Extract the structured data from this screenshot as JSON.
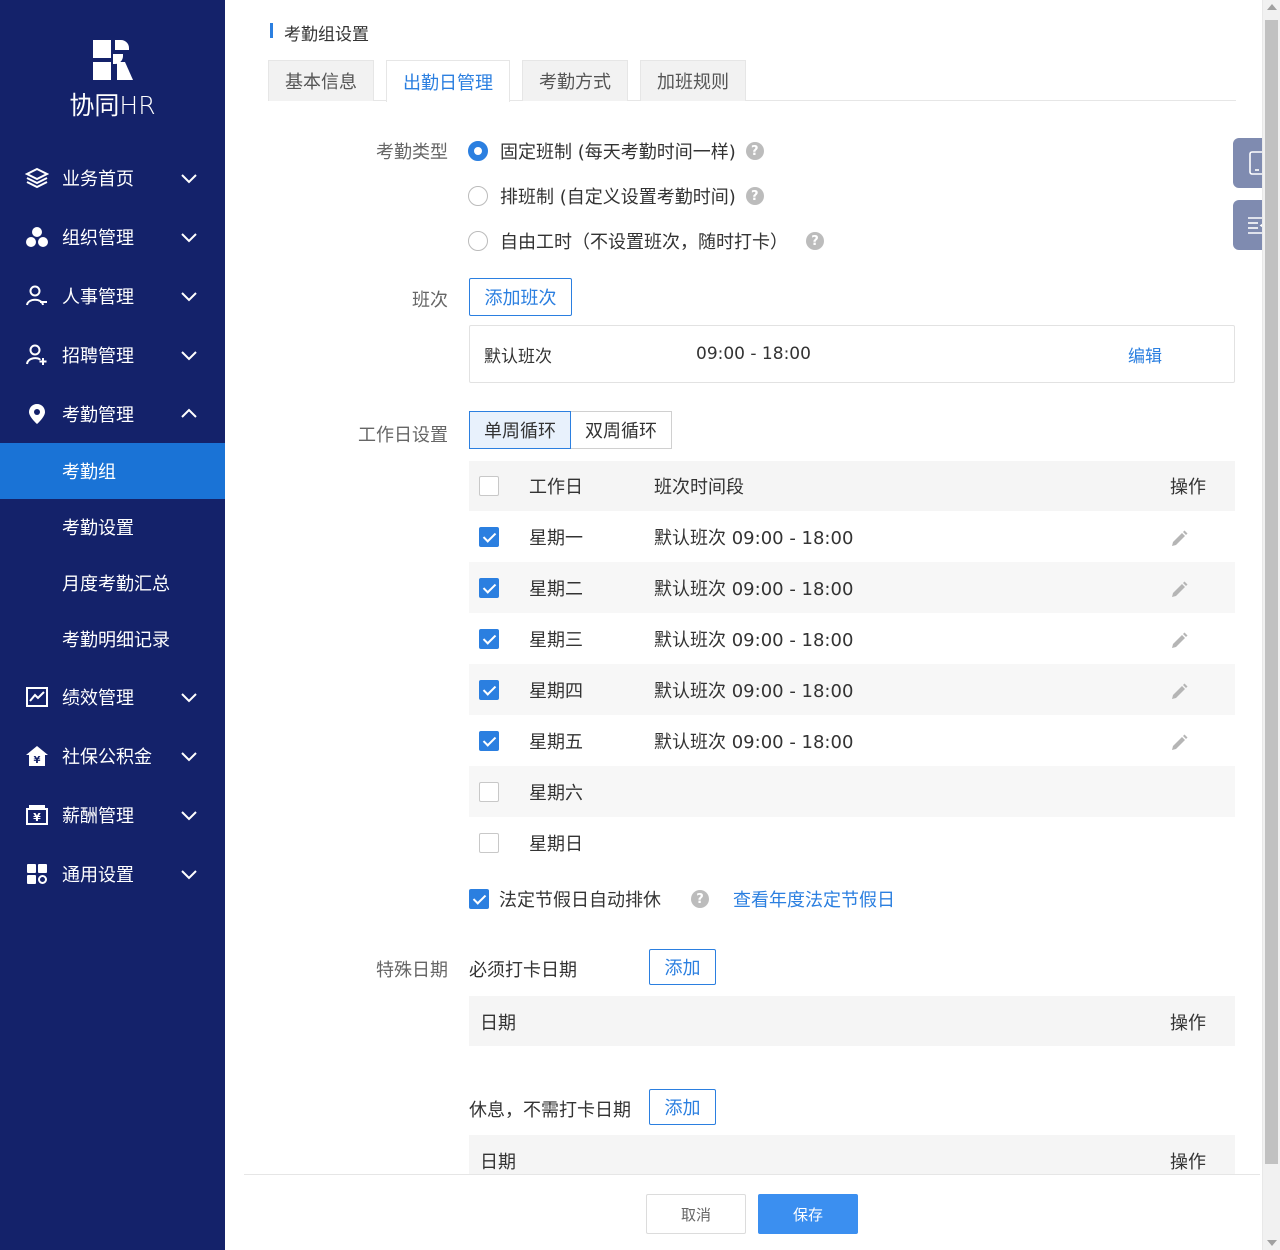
{
  "brand": {
    "name": "协同HR"
  },
  "sidebar": {
    "items": [
      {
        "label": "业务首页",
        "icon": "layers-icon",
        "expanded": false
      },
      {
        "label": "组织管理",
        "icon": "org-icon",
        "expanded": false
      },
      {
        "label": "人事管理",
        "icon": "person-icon",
        "expanded": false
      },
      {
        "label": "招聘管理",
        "icon": "person-add-icon",
        "expanded": false
      },
      {
        "label": "考勤管理",
        "icon": "location-pin-icon",
        "expanded": true,
        "children": [
          {
            "label": "考勤组",
            "active": true
          },
          {
            "label": "考勤设置",
            "active": false
          },
          {
            "label": "月度考勤汇总",
            "active": false
          },
          {
            "label": "考勤明细记录",
            "active": false
          }
        ]
      },
      {
        "label": "绩效管理",
        "icon": "chart-icon",
        "expanded": false
      },
      {
        "label": "社保公积金",
        "icon": "house-yen-icon",
        "expanded": false
      },
      {
        "label": "薪酬管理",
        "icon": "wallet-yen-icon",
        "expanded": false
      },
      {
        "label": "通用设置",
        "icon": "grid-settings-icon",
        "expanded": false
      }
    ]
  },
  "page": {
    "title": "考勤组设置",
    "tabs": [
      {
        "label": "基本信息",
        "active": false
      },
      {
        "label": "出勤日管理",
        "active": true
      },
      {
        "label": "考勤方式",
        "active": false
      },
      {
        "label": "加班规则",
        "active": false
      }
    ]
  },
  "attendance_type": {
    "label": "考勤类型",
    "options": [
      {
        "label": "固定班制 (每天考勤时间一样)",
        "selected": true
      },
      {
        "label": "排班制 (自定义设置考勤时间)",
        "selected": false
      },
      {
        "label": "自由工时（不设置班次，随时打卡）",
        "selected": false
      }
    ],
    "help": "?"
  },
  "shift": {
    "label": "班次",
    "add_button": "添加班次",
    "name": "默认班次",
    "time": "09:00 - 18:00",
    "edit": "编辑"
  },
  "workday": {
    "label": "工作日设置",
    "cycle_options": [
      {
        "label": "单周循环",
        "selected": true
      },
      {
        "label": "双周循环",
        "selected": false
      }
    ],
    "headers": {
      "day": "工作日",
      "time": "班次时间段",
      "op": "操作"
    },
    "rows": [
      {
        "day": "星期一",
        "time": "默认班次 09:00 - 18:00",
        "checked": true
      },
      {
        "day": "星期二",
        "time": "默认班次 09:00 - 18:00",
        "checked": true
      },
      {
        "day": "星期三",
        "time": "默认班次 09:00 - 18:00",
        "checked": true
      },
      {
        "day": "星期四",
        "time": "默认班次 09:00 - 18:00",
        "checked": true
      },
      {
        "day": "星期五",
        "time": "默认班次 09:00 - 18:00",
        "checked": true
      },
      {
        "day": "星期六",
        "time": "",
        "checked": false
      },
      {
        "day": "星期日",
        "time": "",
        "checked": false
      }
    ],
    "holiday_auto": {
      "label": "法定节假日自动排休",
      "checked": true,
      "link": "查看年度法定节假日"
    }
  },
  "special_dates": {
    "label": "特殊日期",
    "must_clock": {
      "title": "必须打卡日期",
      "add": "添加",
      "col_date": "日期",
      "col_op": "操作"
    },
    "rest": {
      "title": "休息，不需打卡日期",
      "add": "添加",
      "col_date": "日期",
      "col_op": "操作"
    }
  },
  "footer": {
    "cancel": "取消",
    "save": "保存"
  },
  "colors": {
    "sidebar_bg": "#14226a",
    "active_item": "#1a73d6",
    "accent": "#2b7fe0",
    "save_button": "#3b8ff0"
  }
}
